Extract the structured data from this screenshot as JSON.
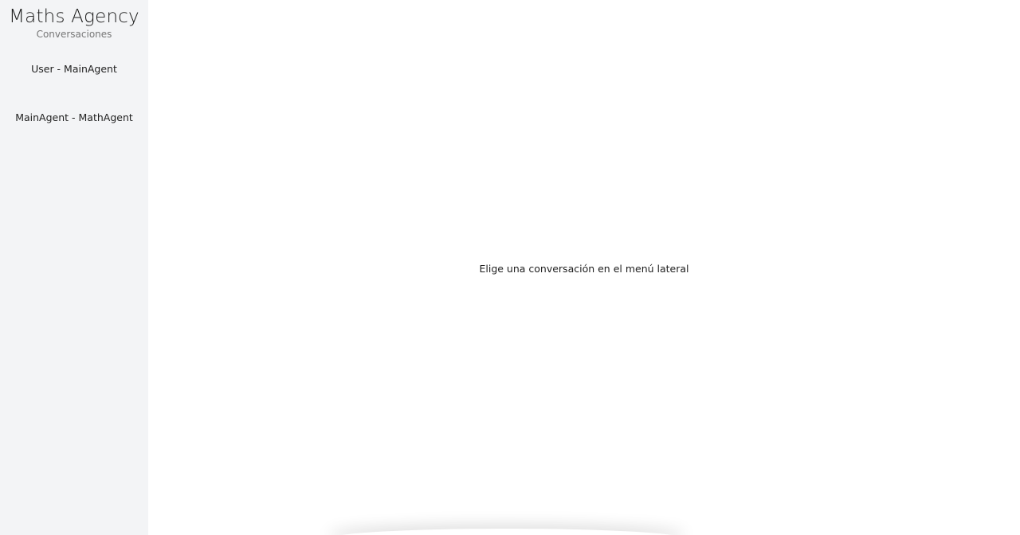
{
  "sidebar": {
    "title": "Maths Agency",
    "subtitle": "Conversaciones",
    "items": [
      {
        "label": "User - MainAgent"
      },
      {
        "label": "MainAgent - MathAgent"
      }
    ]
  },
  "main": {
    "empty_hint": "Elige una conversación en el menú lateral"
  },
  "colors": {
    "sidebar_bg": "#f3f4f6",
    "main_bg": "#ffffff",
    "text": "#1f1f1f",
    "subtitle": "#777777"
  }
}
